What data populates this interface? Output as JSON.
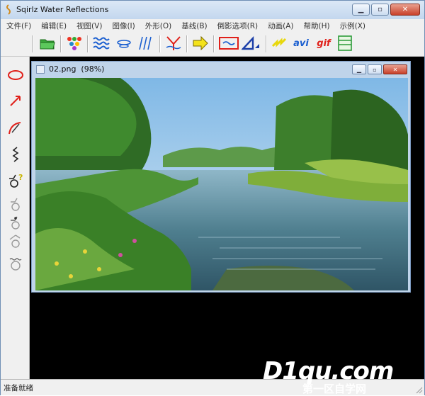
{
  "window": {
    "title": "Sqirlz Water Reflections"
  },
  "menubar": {
    "items": [
      {
        "label": "文件(F)"
      },
      {
        "label": "编辑(E)"
      },
      {
        "label": "视图(V)"
      },
      {
        "label": "图像(I)"
      },
      {
        "label": "外形(O)"
      },
      {
        "label": "基线(B)"
      },
      {
        "label": "倒影选项(R)"
      },
      {
        "label": "动画(A)"
      },
      {
        "label": "帮助(H)"
      },
      {
        "label": "示例(X)"
      }
    ]
  },
  "toolbar": {
    "avi_label": "avi",
    "gif_label": "gif"
  },
  "document": {
    "title": "02.png  (98%)"
  },
  "statusbar": {
    "text": "准备就绪"
  },
  "watermark": {
    "main": "D1qu.com",
    "sub": "第一区自学网"
  },
  "colors": {
    "accent_red": "#e0201a",
    "accent_blue": "#1c57c9",
    "titlebar": "#c3d7ee"
  }
}
